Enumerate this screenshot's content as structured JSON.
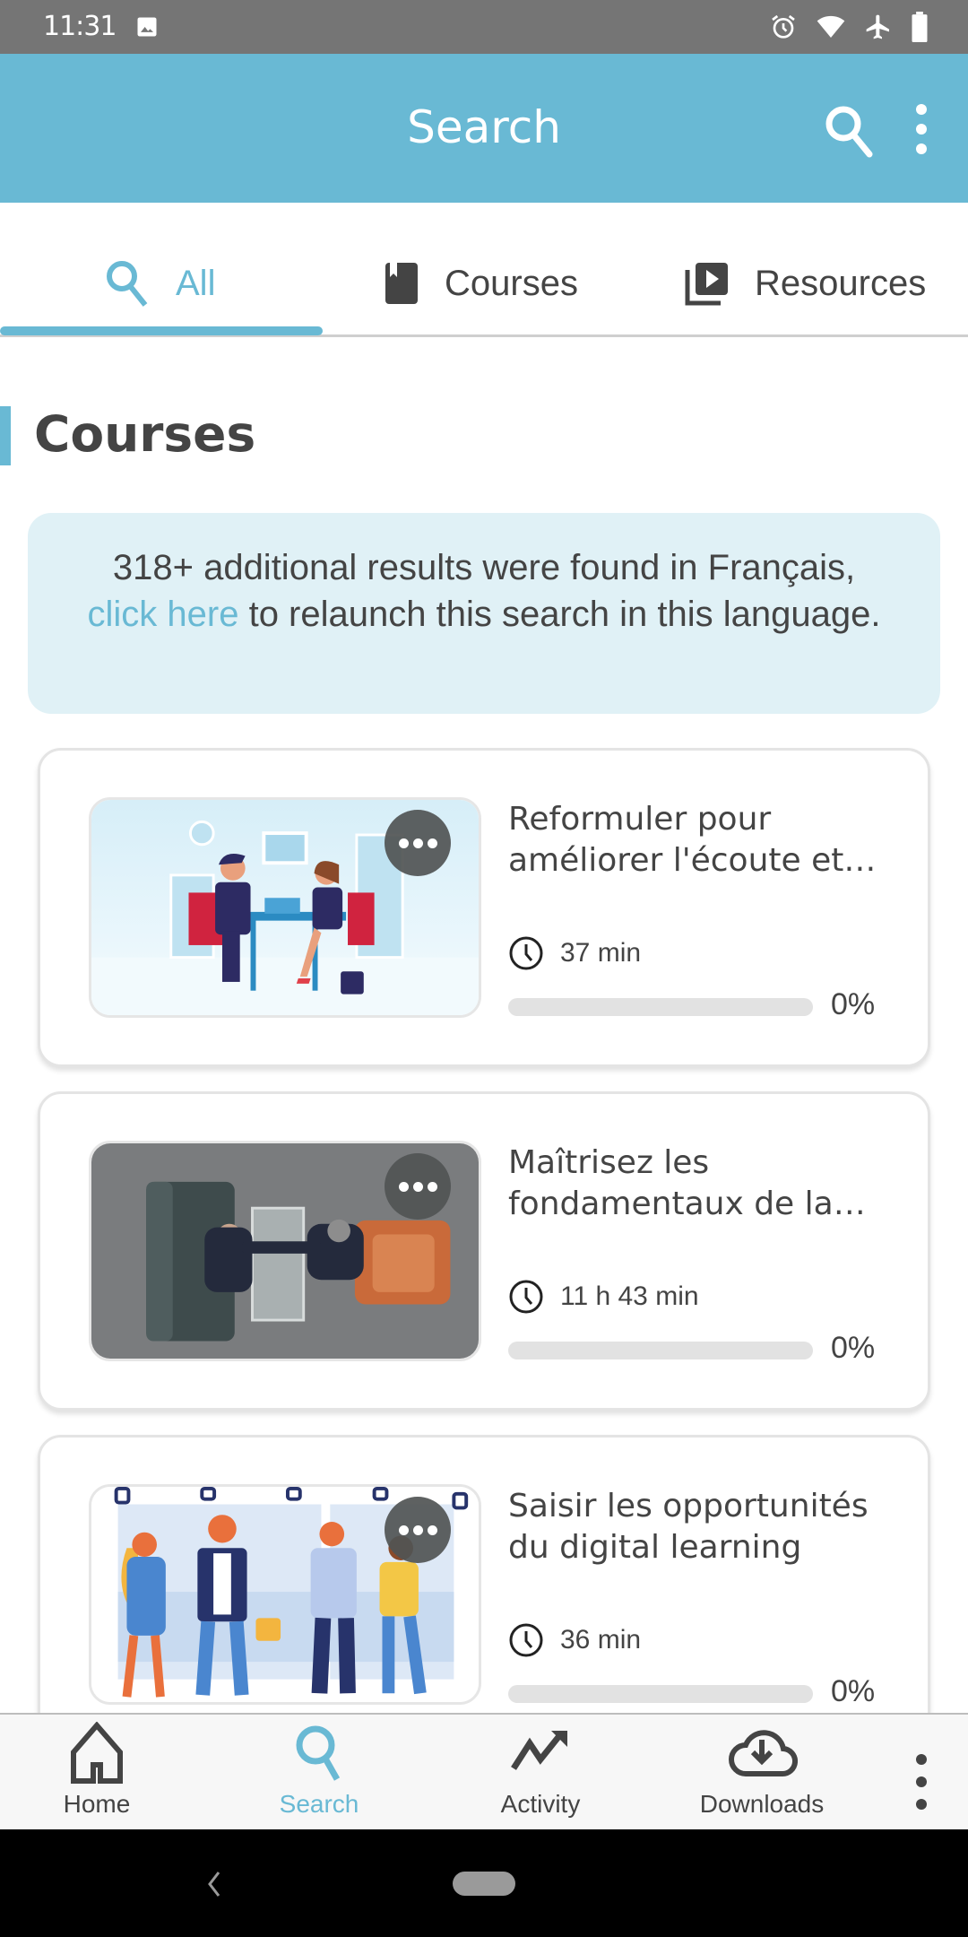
{
  "status_bar": {
    "time": "11:31",
    "icons": [
      "image-icon",
      "alarm-icon",
      "wifi-icon",
      "airplane-mode-icon",
      "battery-icon"
    ]
  },
  "app_bar": {
    "title": "Search",
    "actions": [
      "search-icon",
      "more-vertical-icon"
    ]
  },
  "tabs": [
    {
      "label": "All",
      "icon": "search-icon",
      "active": true
    },
    {
      "label": "Courses",
      "icon": "book-icon",
      "active": false
    },
    {
      "label": "Resources",
      "icon": "video-library-icon",
      "active": false
    }
  ],
  "section": {
    "title": "Courses"
  },
  "notice": {
    "text_before": "318+ additional results were found in Français,",
    "link": "click here",
    "text_after": " to relaunch this search in this language."
  },
  "courses": [
    {
      "title": "Reformuler pour améliorer l'écoute et l...",
      "duration": "37 min",
      "progress_percent": 0,
      "progress_label": "0%",
      "thumbnail": "illustration-office-meeting"
    },
    {
      "title": "Maîtrisez les fondamentaux de la v...",
      "duration": "11 h 43 min",
      "progress_percent": 0,
      "progress_label": "0%",
      "thumbnail": "photo-handshake-lounge"
    },
    {
      "title": "Saisir les opportunités du digital learning",
      "duration": "36 min",
      "progress_percent": 0,
      "progress_label": "0%",
      "thumbnail": "illustration-commuters-phones"
    }
  ],
  "bottom_nav": [
    {
      "label": "Home",
      "icon": "home-icon",
      "active": false
    },
    {
      "label": "Search",
      "icon": "search-icon",
      "active": true
    },
    {
      "label": "Activity",
      "icon": "trending-up-icon",
      "active": false
    },
    {
      "label": "Downloads",
      "icon": "cloud-download-icon",
      "active": false
    }
  ],
  "colors": {
    "accent": "#69b9d4",
    "status_bar": "#757575",
    "notice_bg": "#e0f1f6",
    "text": "#444444"
  }
}
